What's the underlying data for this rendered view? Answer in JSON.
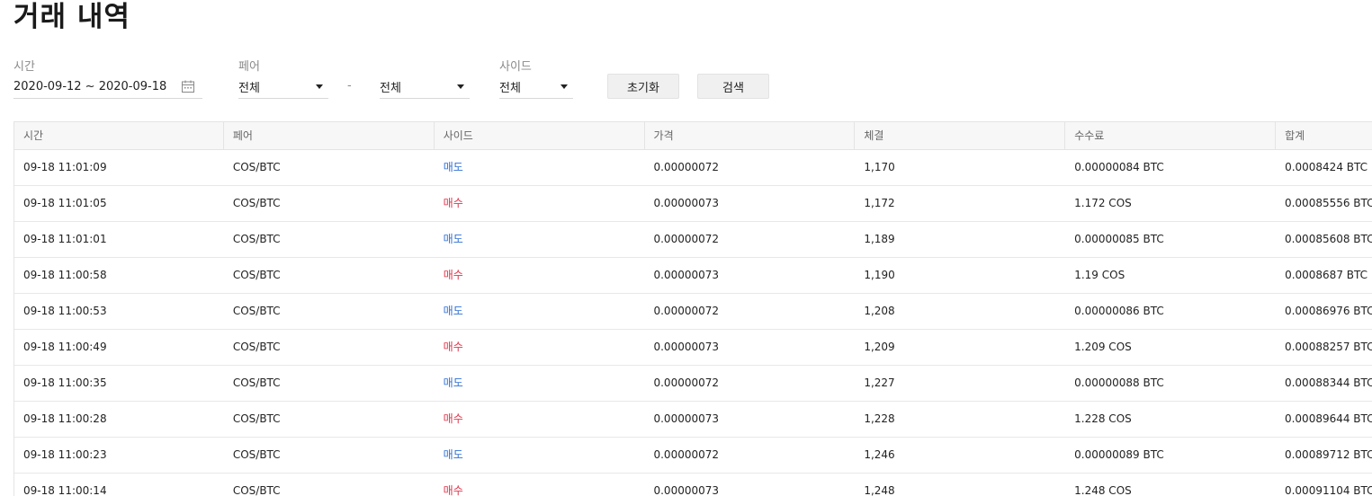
{
  "page": {
    "title": "거래 내역"
  },
  "filters": {
    "time": {
      "label": "시간",
      "value": "2020-09-12 ~ 2020-09-18",
      "icon": "calendar-icon"
    },
    "pair": {
      "label": "페어",
      "base_value": "전체",
      "separator": "-",
      "quote_value": "전체"
    },
    "side": {
      "label": "사이드",
      "value": "전체"
    },
    "reset_label": "초기화",
    "search_label": "검색"
  },
  "colors": {
    "sell": "#2f6fd6",
    "buy": "#e0334a",
    "header_bg": "#f7f7f7"
  },
  "table": {
    "columns": [
      "시간",
      "페어",
      "사이드",
      "가격",
      "체결",
      "수수료",
      "합계"
    ],
    "rows": [
      {
        "time": "09-18 11:01:09",
        "pair": "COS/BTC",
        "side": "매도",
        "side_type": "sell",
        "price": "0.00000072",
        "filled": "1,170",
        "fee": "0.00000084 BTC",
        "total": "0.0008424 BTC"
      },
      {
        "time": "09-18 11:01:05",
        "pair": "COS/BTC",
        "side": "매수",
        "side_type": "buy",
        "price": "0.00000073",
        "filled": "1,172",
        "fee": "1.172 COS",
        "total": "0.00085556 BTC"
      },
      {
        "time": "09-18 11:01:01",
        "pair": "COS/BTC",
        "side": "매도",
        "side_type": "sell",
        "price": "0.00000072",
        "filled": "1,189",
        "fee": "0.00000085 BTC",
        "total": "0.00085608 BTC"
      },
      {
        "time": "09-18 11:00:58",
        "pair": "COS/BTC",
        "side": "매수",
        "side_type": "buy",
        "price": "0.00000073",
        "filled": "1,190",
        "fee": "1.19 COS",
        "total": "0.0008687 BTC"
      },
      {
        "time": "09-18 11:00:53",
        "pair": "COS/BTC",
        "side": "매도",
        "side_type": "sell",
        "price": "0.00000072",
        "filled": "1,208",
        "fee": "0.00000086 BTC",
        "total": "0.00086976 BTC"
      },
      {
        "time": "09-18 11:00:49",
        "pair": "COS/BTC",
        "side": "매수",
        "side_type": "buy",
        "price": "0.00000073",
        "filled": "1,209",
        "fee": "1.209 COS",
        "total": "0.00088257 BTC"
      },
      {
        "time": "09-18 11:00:35",
        "pair": "COS/BTC",
        "side": "매도",
        "side_type": "sell",
        "price": "0.00000072",
        "filled": "1,227",
        "fee": "0.00000088 BTC",
        "total": "0.00088344 BTC"
      },
      {
        "time": "09-18 11:00:28",
        "pair": "COS/BTC",
        "side": "매수",
        "side_type": "buy",
        "price": "0.00000073",
        "filled": "1,228",
        "fee": "1.228 COS",
        "total": "0.00089644 BTC"
      },
      {
        "time": "09-18 11:00:23",
        "pair": "COS/BTC",
        "side": "매도",
        "side_type": "sell",
        "price": "0.00000072",
        "filled": "1,246",
        "fee": "0.00000089 BTC",
        "total": "0.00089712 BTC"
      },
      {
        "time": "09-18 11:00:14",
        "pair": "COS/BTC",
        "side": "매수",
        "side_type": "buy",
        "price": "0.00000073",
        "filled": "1,248",
        "fee": "1.248 COS",
        "total": "0.00091104 BTC"
      }
    ]
  }
}
